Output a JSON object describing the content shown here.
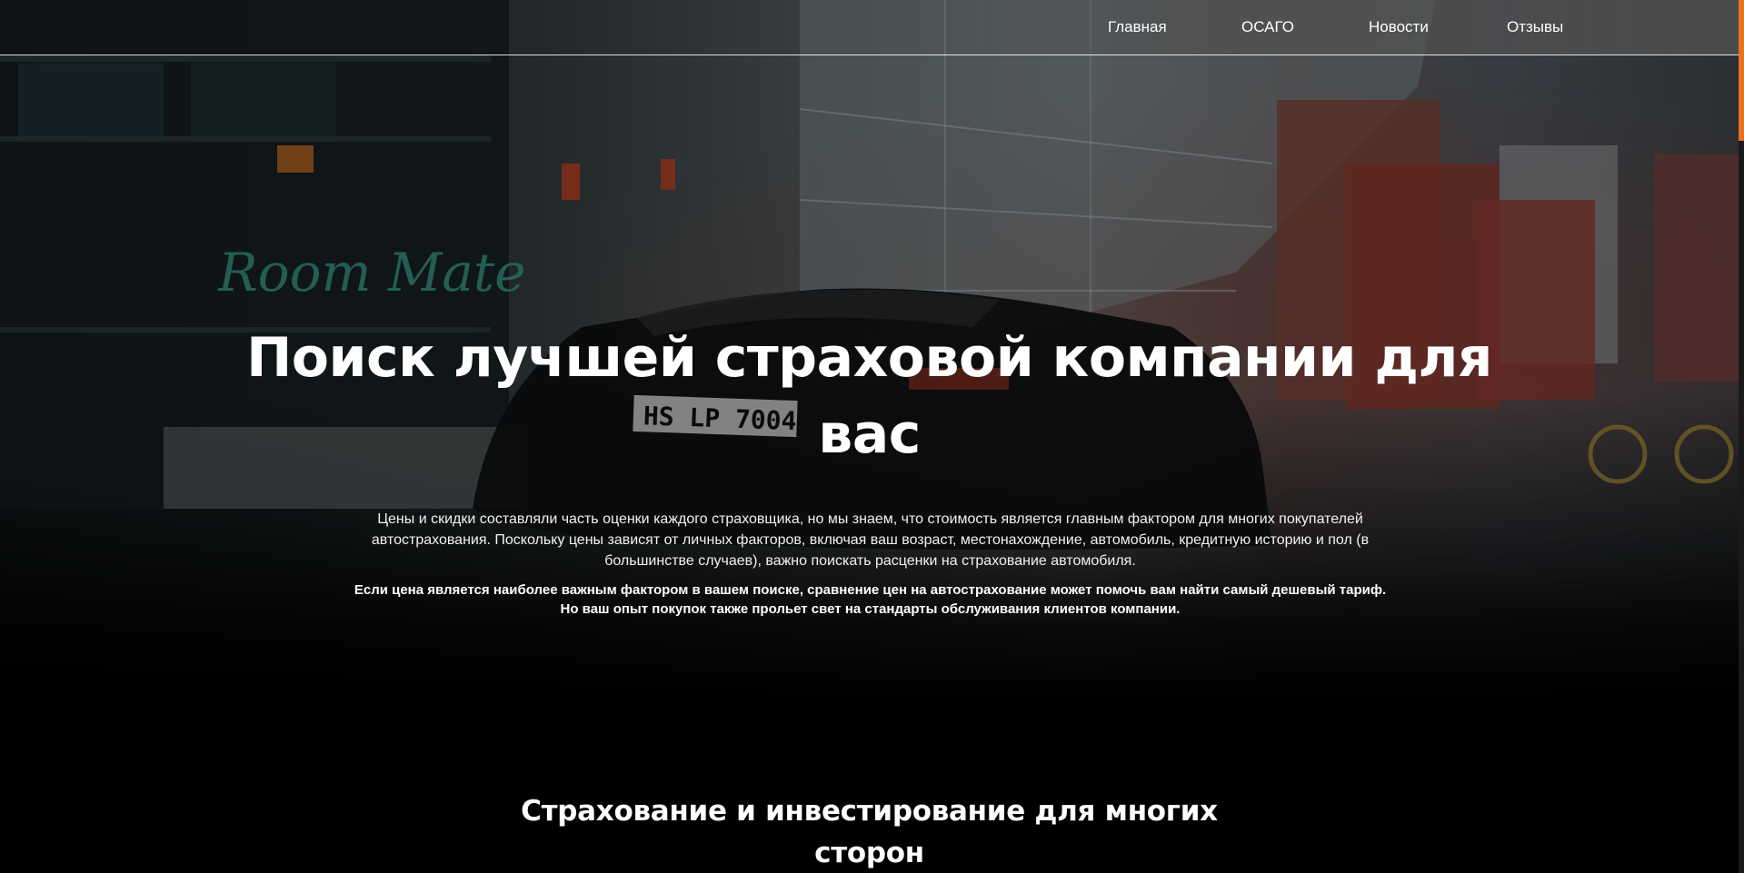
{
  "nav": {
    "items": [
      {
        "label": "Главная"
      },
      {
        "label": "ОСАГО"
      },
      {
        "label": "Новости"
      },
      {
        "label": "Отзывы"
      }
    ]
  },
  "hero": {
    "title": "Поиск лучшей страховой компании для вас",
    "paragraph": "Цены и скидки составляли часть оценки каждого страховщика, но мы знаем, что стоимость является главным фактором для многих покупателей автострахования. Поскольку цены зависят от личных факторов, включая ваш возраст, местонахождение, автомобиль, кредитную историю и пол (в большинстве случаев), важно поискать расценки на страхование автомобиля.",
    "paragraph_bold": "Если цена является наиболее важным фактором в вашем поиске, сравнение цен на автострахование может помочь вам найти самый дешевый тариф. Но ваш опыт покупок также прольет свет на стандарты обслуживания клиентов компании.",
    "background": {
      "sign_text": "Room Mate",
      "plate_text": "HS LP 7004"
    }
  },
  "section": {
    "title": "Страхование и инвестирование для многих сторон"
  },
  "colors": {
    "accent": "#e8731f",
    "text": "#ffffff",
    "background": "#000000"
  }
}
